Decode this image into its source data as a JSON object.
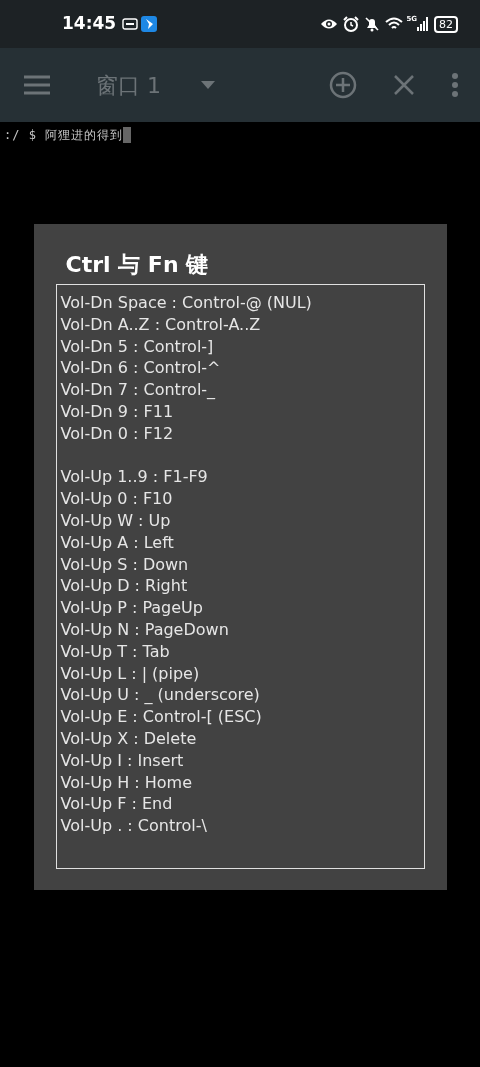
{
  "status_bar": {
    "time": "14:45",
    "network": "5G",
    "battery": "82"
  },
  "toolbar": {
    "window_title": "窗口 1"
  },
  "terminal": {
    "prompt": ":/ $ 阿狸进的得到"
  },
  "dialog": {
    "title": "Ctrl 与 Fn 键",
    "groups": [
      [
        "Vol-Dn Space : Control-@ (NUL)",
        "Vol-Dn A..Z : Control-A..Z",
        "Vol-Dn 5 : Control-]",
        "Vol-Dn 6 : Control-^",
        "Vol-Dn 7 : Control-_",
        "Vol-Dn 9 : F11",
        "Vol-Dn 0 : F12"
      ],
      [
        "Vol-Up 1..9 : F1-F9",
        "Vol-Up 0 : F10",
        "Vol-Up W : Up",
        "Vol-Up A : Left",
        "Vol-Up S : Down",
        "Vol-Up D : Right",
        "Vol-Up P : PageUp",
        "Vol-Up N : PageDown",
        "Vol-Up T : Tab",
        "Vol-Up L : | (pipe)",
        "Vol-Up U : _ (underscore)",
        "Vol-Up E : Control-[ (ESC)",
        "Vol-Up X : Delete",
        "Vol-Up I : Insert",
        "Vol-Up H : Home",
        "Vol-Up F : End",
        "Vol-Up . : Control-\\"
      ]
    ]
  }
}
